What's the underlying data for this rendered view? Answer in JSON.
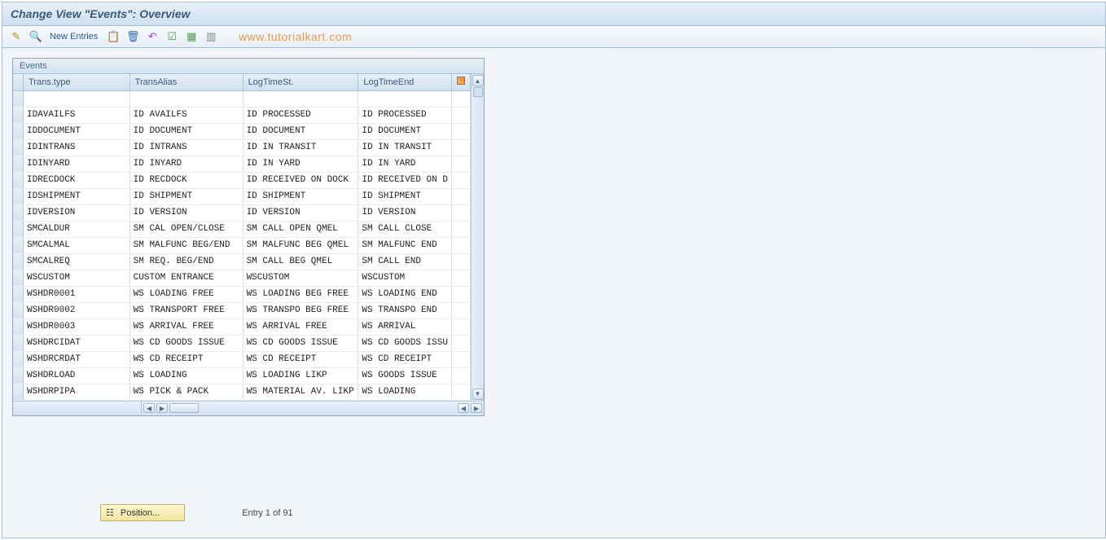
{
  "header": {
    "title": "Change View \"Events\": Overview"
  },
  "toolbar": {
    "new_entries_label": "New Entries",
    "watermark": "www.tutorialkart.com"
  },
  "grid": {
    "title": "Events",
    "columns": {
      "trans_type": "Trans.type",
      "trans_alias": "TransAlias",
      "log_time_st": "LogTimeSt.",
      "log_time_end": "LogTimeEnd"
    },
    "rows": [
      {
        "type": "",
        "alias": "",
        "st": "",
        "end": ""
      },
      {
        "type": "IDAVAILFS",
        "alias": "ID AVAILFS",
        "st": "ID PROCESSED",
        "end": "ID PROCESSED"
      },
      {
        "type": "IDDOCUMENT",
        "alias": "ID DOCUMENT",
        "st": "ID DOCUMENT",
        "end": "ID DOCUMENT"
      },
      {
        "type": "IDINTRANS",
        "alias": "ID INTRANS",
        "st": "ID IN TRANSIT",
        "end": "ID IN TRANSIT"
      },
      {
        "type": "IDINYARD",
        "alias": "ID INYARD",
        "st": "ID IN YARD",
        "end": "ID IN YARD"
      },
      {
        "type": "IDRECDOCK",
        "alias": "ID RECDOCK",
        "st": "ID RECEIVED ON DOCK",
        "end": "ID RECEIVED ON D"
      },
      {
        "type": "IDSHIPMENT",
        "alias": "ID SHIPMENT",
        "st": "ID SHIPMENT",
        "end": "ID SHIPMENT"
      },
      {
        "type": "IDVERSION",
        "alias": "ID VERSION",
        "st": "ID VERSION",
        "end": "ID VERSION"
      },
      {
        "type": "SMCALDUR",
        "alias": "SM CAL OPEN/CLOSE",
        "st": "SM CALL OPEN    QMEL",
        "end": "SM CALL CLOSE"
      },
      {
        "type": "SMCALMAL",
        "alias": "SM MALFUNC BEG/END",
        "st": "SM MALFUNC BEG  QMEL",
        "end": "SM MALFUNC END"
      },
      {
        "type": "SMCALREQ",
        "alias": "SM REQ. BEG/END",
        "st": "SM CALL BEG     QMEL",
        "end": "SM CALL END"
      },
      {
        "type": "WSCUSTOM",
        "alias": "CUSTOM ENTRANCE",
        "st": "WSCUSTOM",
        "end": "WSCUSTOM"
      },
      {
        "type": "WSHDR0001",
        "alias": "WS LOADING     FREE",
        "st": "WS LOADING BEG  FREE",
        "end": "WS LOADING END"
      },
      {
        "type": "WSHDR0002",
        "alias": "WS TRANSPORT   FREE",
        "st": "WS TRANSPO BEG  FREE",
        "end": "WS TRANSPO END"
      },
      {
        "type": "WSHDR0003",
        "alias": "WS ARRIVAL     FREE",
        "st": "WS ARRIVAL      FREE",
        "end": "WS ARRIVAL"
      },
      {
        "type": "WSHDRCIDAT",
        "alias": "WS CD GOODS ISSUE",
        "st": "WS CD GOODS ISSUE",
        "end": "WS CD GOODS ISSU"
      },
      {
        "type": "WSHDRCRDAT",
        "alias": "WS CD RECEIPT",
        "st": "WS CD RECEIPT",
        "end": "WS CD RECEIPT"
      },
      {
        "type": "WSHDRLOAD",
        "alias": "WS LOADING",
        "st": "WS LOADING      LIKP",
        "end": "WS GOODS ISSUE"
      },
      {
        "type": "WSHDRPIPA",
        "alias": "WS PICK & PACK",
        "st": "WS MATERIAL AV. LIKP",
        "end": "WS LOADING"
      }
    ]
  },
  "footer": {
    "position_label": "Position...",
    "entry_label": "Entry 1 of 91"
  }
}
